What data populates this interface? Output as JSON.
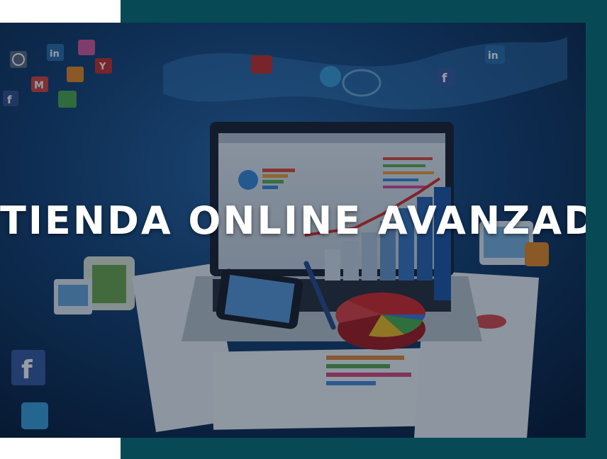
{
  "banner": {
    "title": "TIENDA ONLINE AVANZADA"
  },
  "colors": {
    "frame_teal": "#074a55",
    "background_blue": "#0b2a4e",
    "title_text": "#ffffff"
  },
  "icons": [
    "wordpress-icon",
    "linkedin-icon",
    "flickr-icon",
    "gmail-icon",
    "rss-icon",
    "yahoo-icon",
    "youtube-icon",
    "twitter-icon",
    "facebook-icon",
    "recycle-icon"
  ]
}
